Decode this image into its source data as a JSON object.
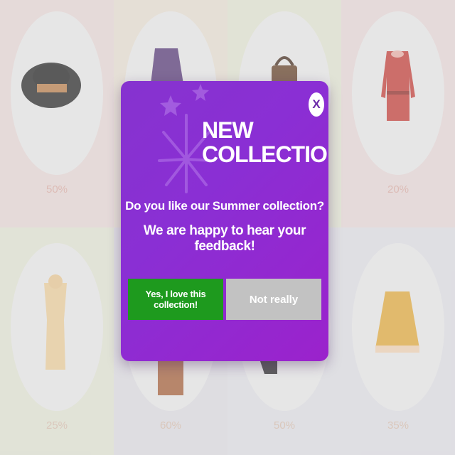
{
  "products": [
    {
      "name": "hat",
      "discount": "50%",
      "tile_color": "#e7d6d4"
    },
    {
      "name": "skirt",
      "discount": "",
      "tile_color": "#e7ddd0"
    },
    {
      "name": "handbag",
      "discount": "",
      "tile_color": "#e1e3cf"
    },
    {
      "name": "red-dress",
      "discount": "20%",
      "tile_color": "#e7d6d6"
    },
    {
      "name": "necklace",
      "discount": "25%",
      "tile_color": "#e0e3d2"
    },
    {
      "name": "boots",
      "discount": "60%",
      "tile_color": "#dcdbe1"
    },
    {
      "name": "heels",
      "discount": "50%",
      "tile_color": "#dddde3"
    },
    {
      "name": "yellow-skirt",
      "discount": "35%",
      "tile_color": "#dedde4"
    }
  ],
  "modal": {
    "close_label": "X",
    "headline_line1": "NEW",
    "headline_line2": "COLLECTION",
    "question": "Do you like our Summer collection?",
    "subtext": "We are happy to hear your feedback!",
    "yes_label": "Yes, I love this collection!",
    "no_label": "Not really",
    "colors": {
      "primary": "#8a2fd4",
      "yes": "#1e9a1e",
      "no": "#c2c2c2"
    }
  }
}
